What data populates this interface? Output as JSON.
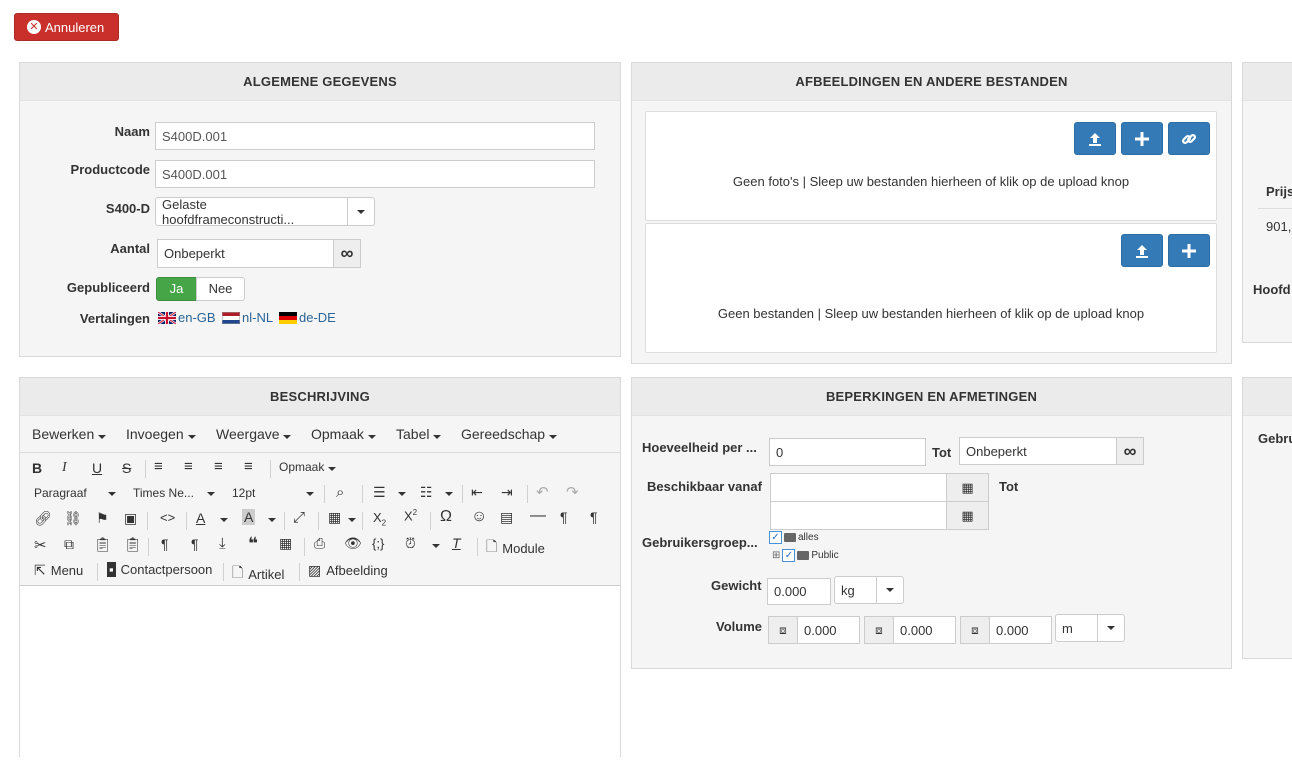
{
  "toolbar": {
    "cancel_label": "Annuleren"
  },
  "general": {
    "title": "ALGEMENE GEGEVENS",
    "name_label": "Naam",
    "name_value": "S400D.001",
    "code_label": "Productcode",
    "code_value": "S400D.001",
    "category_label": "S400-D",
    "category_value": "Gelaste hoofdframeconstructi...",
    "quantity_label": "Aantal",
    "quantity_value": "Onbeperkt",
    "published_label": "Gepubliceerd",
    "published_yes": "Ja",
    "published_no": "Nee",
    "translations_label": "Vertalingen",
    "translations": [
      "en-GB",
      "nl-NL",
      "de-DE"
    ]
  },
  "files": {
    "title": "AFBEELDINGEN EN ANDERE BESTANDEN",
    "photos_empty": "Geen foto's | Sleep uw bestanden hierheen of klik op de upload knop",
    "files_empty": "Geen bestanden | Sleep uw bestanden hierheen of klik op de upload knop"
  },
  "right_panel": {
    "label_price": "Prijs",
    "value_price": "901,",
    "label_main": "Hoofd",
    "label_groups": "Gebru"
  },
  "description": {
    "title": "BESCHRIJVING",
    "menus": [
      "Bewerken",
      "Invoegen",
      "Weergave",
      "Opmaak",
      "Tabel",
      "Gereedschap"
    ],
    "formats_label": "Opmaak",
    "paragraph_label": "Paragraaf",
    "font_label": "Times Ne...",
    "size_label": "12pt",
    "module_label": "Module",
    "menu_label": "Menu",
    "contact_label": "Contactpersoon",
    "article_label": "Artikel",
    "image_label": "Afbeelding"
  },
  "limits": {
    "title": "BEPERKINGEN EN AFMETINGEN",
    "qty_per_label": "Hoeveelheid per ...",
    "qty_from": "0",
    "to_label": "Tot",
    "qty_to": "Onbeperkt",
    "available_label": "Beschikbaar vanaf",
    "available_to_label": "Tot",
    "usergroups_label": "Gebruikersgroep...",
    "groups": [
      "alles",
      "Public"
    ],
    "weight_label": "Gewicht",
    "weight_value": "0.000",
    "weight_unit": "kg",
    "volume_label": "Volume",
    "volume_values": [
      "0.000",
      "0.000",
      "0.000"
    ],
    "volume_unit": "m"
  }
}
